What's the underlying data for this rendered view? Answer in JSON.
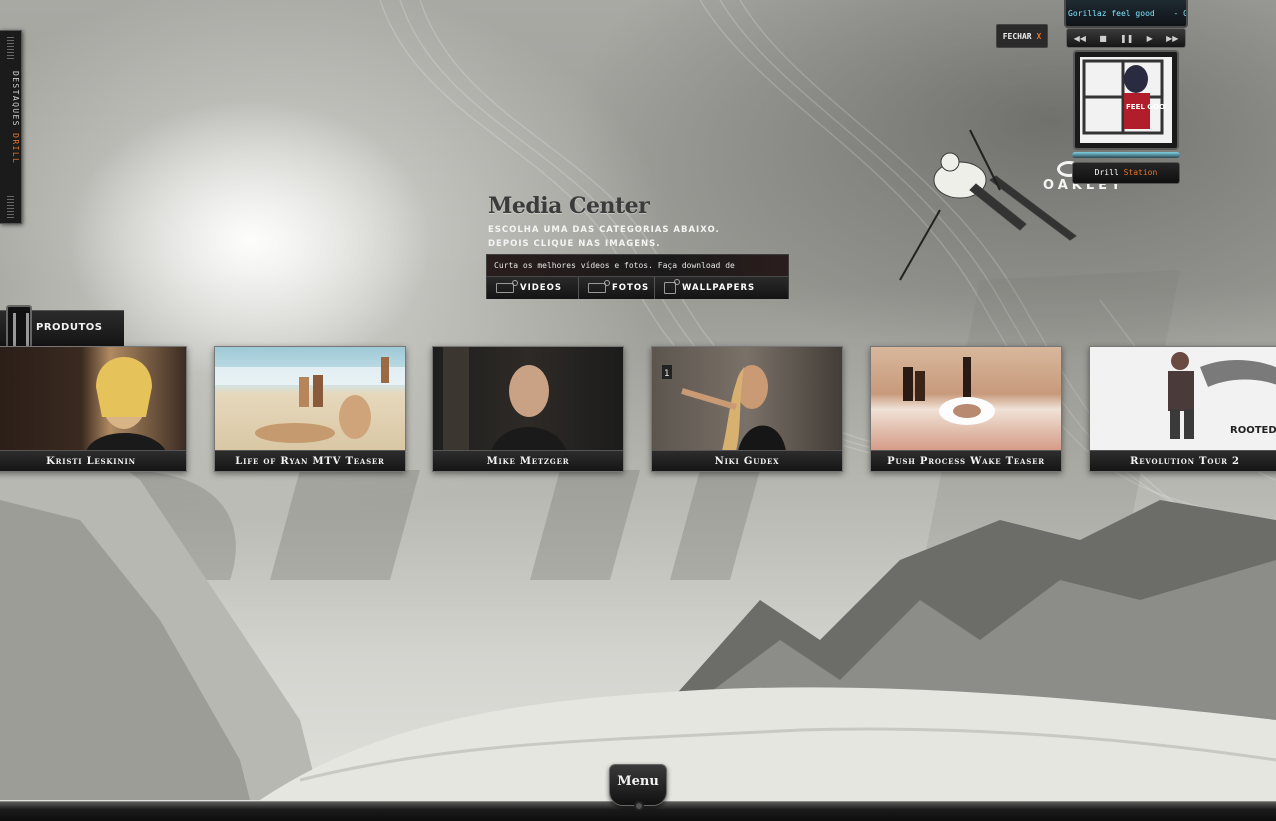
{
  "side_tab": {
    "label_main": "DESTAQUES",
    "label_accent": "DRILL"
  },
  "produtos": {
    "label": "PRODUTOS"
  },
  "media_center": {
    "title": "Media Center",
    "subtitle_line1": "Escolha uma das categorias abaixo.",
    "subtitle_line2": "Depois clique nas imagens.",
    "description": "Curta os melhores vídeos e fotos. Faça download de wallpapers.",
    "categories": [
      {
        "label": "VIDEOS",
        "icon": "video-icon"
      },
      {
        "label": "FOTOS",
        "icon": "camera-icon"
      },
      {
        "label": "WALLPAPERS",
        "icon": "monitor-icon"
      }
    ]
  },
  "videos": [
    {
      "title": "Kristi Leskinin"
    },
    {
      "title": "Life of Ryan MTV Teaser"
    },
    {
      "title": "Mike Metzger"
    },
    {
      "title": "Niki Gudex"
    },
    {
      "title": "Push Process Wake Teaser"
    },
    {
      "title": "Revolution Tour 2"
    }
  ],
  "thumb_extras": {
    "rooted": "ROOTED",
    "sign_number": "1"
  },
  "brand": {
    "name": "OAKLEY"
  },
  "close_button": {
    "label": "FECHAR",
    "x": "X"
  },
  "player": {
    "now_playing": "Gorillaz feel good",
    "artist": "- Gorill",
    "station_main": "Drill",
    "station_accent": "Station",
    "art_text": "FEEL GOOD",
    "controls": [
      "◀◀",
      "■",
      "❚❚",
      "▶",
      "▶▶"
    ]
  },
  "menu": {
    "label": "Menu"
  }
}
